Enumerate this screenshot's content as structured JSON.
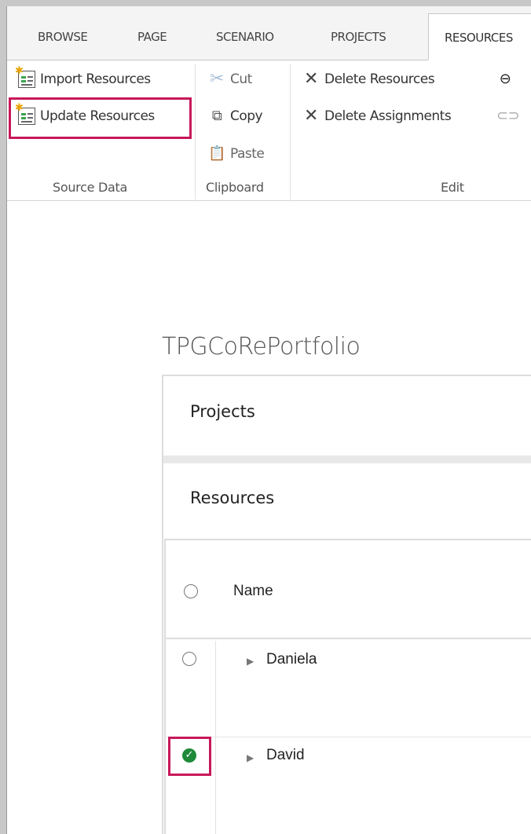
{
  "tabs": [
    {
      "label": "BROWSE"
    },
    {
      "label": "PAGE"
    },
    {
      "label": "SCENARIO"
    },
    {
      "label": "PROJECTS"
    },
    {
      "label": "RESOURCES",
      "active": true
    }
  ],
  "ribbon": {
    "source_data": {
      "import_label": "Import Resources",
      "update_label": "Update Resources",
      "group_label": "Source Data"
    },
    "clipboard": {
      "cut_label": "Cut",
      "copy_label": "Copy",
      "paste_label": "Paste",
      "group_label": "Clipboard"
    },
    "edit": {
      "delete_resources_label": "Delete Resources",
      "delete_assignments_label": "Delete Assignments",
      "group_label": "Edit"
    }
  },
  "page": {
    "title": "TPGCoRePortfolio",
    "sections": {
      "projects": "Projects",
      "resources": "Resources"
    },
    "grid": {
      "columns": [
        "Name"
      ],
      "rows": [
        {
          "name": "Daniela",
          "selected": false
        },
        {
          "name": "David",
          "selected": true
        }
      ]
    }
  },
  "colors": {
    "highlight": "#c8185a",
    "check_green": "#1f8a3a"
  }
}
